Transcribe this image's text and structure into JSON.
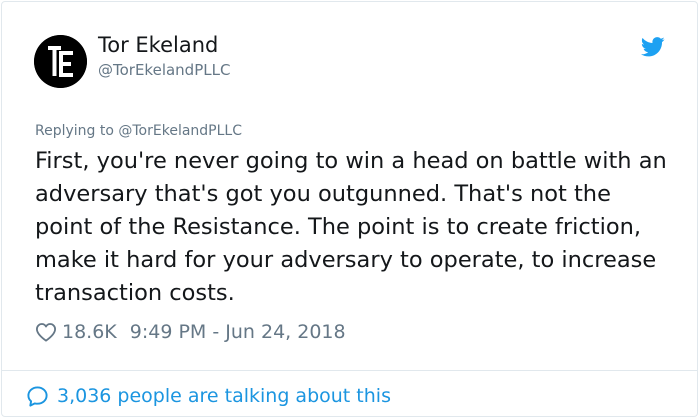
{
  "tweet": {
    "display_name": "Tor Ekeland",
    "handle": "@TorEkelandPLLC",
    "replying_to": "Replying to @TorEkelandPLLC",
    "text": "First, you're never going to win a head on battle with an adversary that's got you outgunned. That's not the point of the Resistance. The point is to create friction, make it hard for your adversary to operate, to increase transaction costs.",
    "likes": "18.6K",
    "timestamp": "9:49 PM - Jun 24, 2018"
  },
  "footer": {
    "talking_text": "3,036 people are talking about this"
  },
  "icons": {
    "avatar": "te-logo",
    "brand": "twitter-bird-icon",
    "like": "heart-icon",
    "conversation": "speech-bubble-icon"
  },
  "colors": {
    "text_primary": "#14171a",
    "text_secondary": "#657786",
    "link_blue": "#1b95e0",
    "twitter_blue": "#1da1f2",
    "border": "#e1e8ed"
  }
}
